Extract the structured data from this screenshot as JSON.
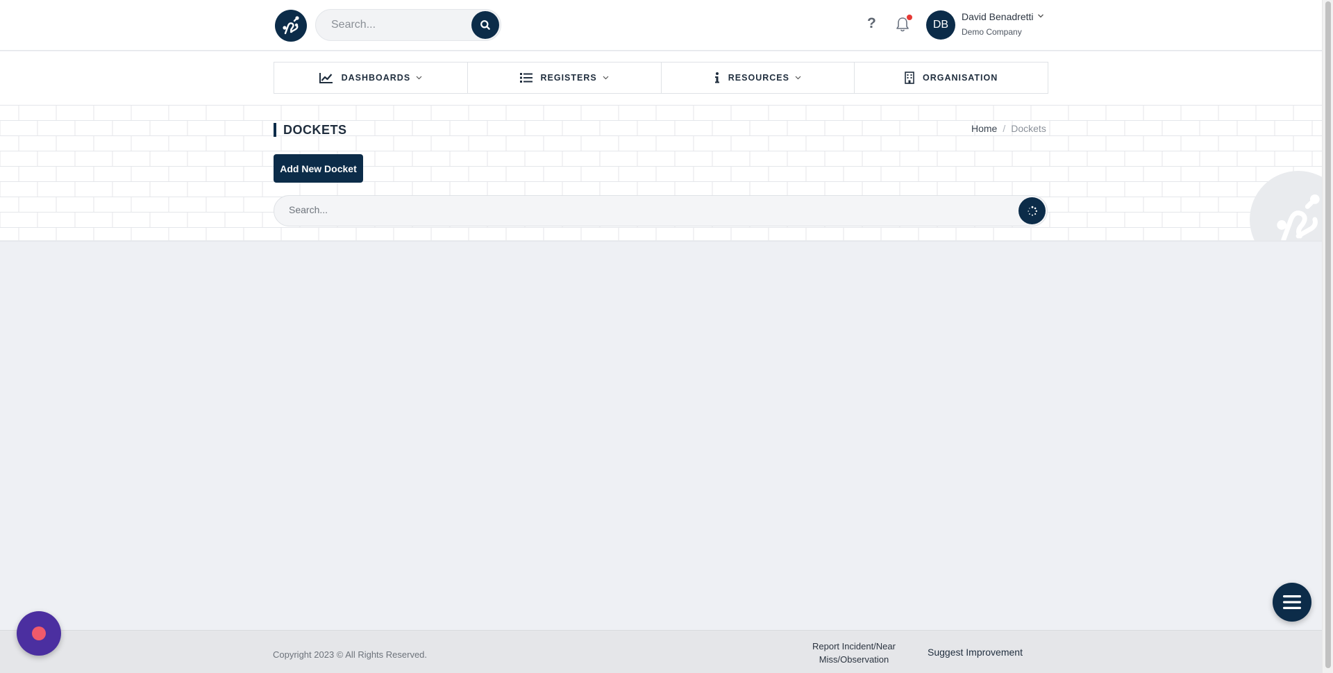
{
  "header": {
    "search_placeholder": "Search...",
    "help_label": "?",
    "user": {
      "initials": "DB",
      "name": "David Benadretti",
      "company": "Demo Company"
    }
  },
  "nav": {
    "items": [
      {
        "label": "DASHBOARDS",
        "icon": "chart-line-icon",
        "has_dropdown": true
      },
      {
        "label": "REGISTERS",
        "icon": "list-icon",
        "has_dropdown": true
      },
      {
        "label": "RESOURCES",
        "icon": "info-icon",
        "has_dropdown": true
      },
      {
        "label": "ORGANISATION",
        "icon": "building-icon",
        "has_dropdown": false
      }
    ]
  },
  "page": {
    "title": "DOCKETS",
    "breadcrumb": {
      "home": "Home",
      "separator": "/",
      "current": "Dockets"
    },
    "add_button": "Add New Docket",
    "search_placeholder": "Search..."
  },
  "footer": {
    "copyright": "Copyright 2023 © All Rights Reserved.",
    "report_line1": "Report Incident/Near",
    "report_line2": "Miss/Observation",
    "suggest": "Suggest Improvement"
  },
  "colors": {
    "brand": "#0c2c49",
    "background": "#eef0f4",
    "notification": "#e53935",
    "chat_fab": "#4b2fa0",
    "chat_dot": "#f05a6b"
  }
}
